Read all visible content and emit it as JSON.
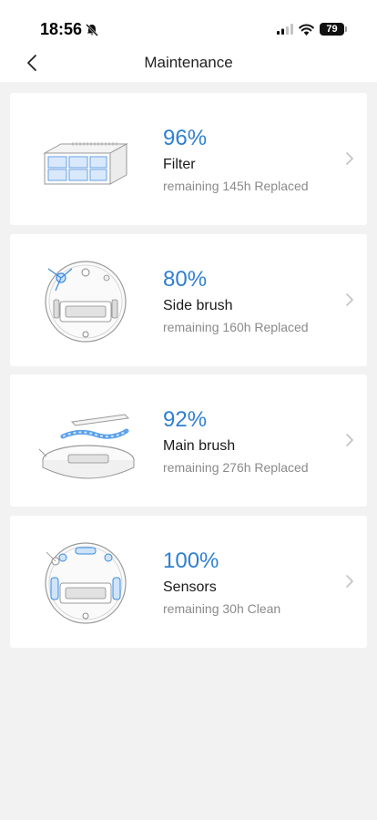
{
  "status_bar": {
    "time": "18:56",
    "battery": "79",
    "icons": [
      "bell-slash-icon",
      "cellular-signal-icon",
      "wifi-icon",
      "battery-icon"
    ]
  },
  "nav": {
    "title": "Maintenance",
    "back_icon": "chevron-left-icon"
  },
  "items": [
    {
      "percent": "96%",
      "name": "Filter",
      "status": "remaining 145h Replaced",
      "image": "filter-illustration"
    },
    {
      "percent": "80%",
      "name": "Side brush",
      "status": "remaining 160h Replaced",
      "image": "robot-side-brush-illustration"
    },
    {
      "percent": "92%",
      "name": "Main brush",
      "status": "remaining 276h Replaced",
      "image": "robot-main-brush-illustration"
    },
    {
      "percent": "100%",
      "name": "Sensors",
      "status": "remaining 30h Clean",
      "image": "robot-sensors-illustration"
    }
  ],
  "colors": {
    "accent": "#2f7fd3",
    "background": "#f2f2f2",
    "card": "#ffffff",
    "secondary_text": "#8a8a8a"
  }
}
